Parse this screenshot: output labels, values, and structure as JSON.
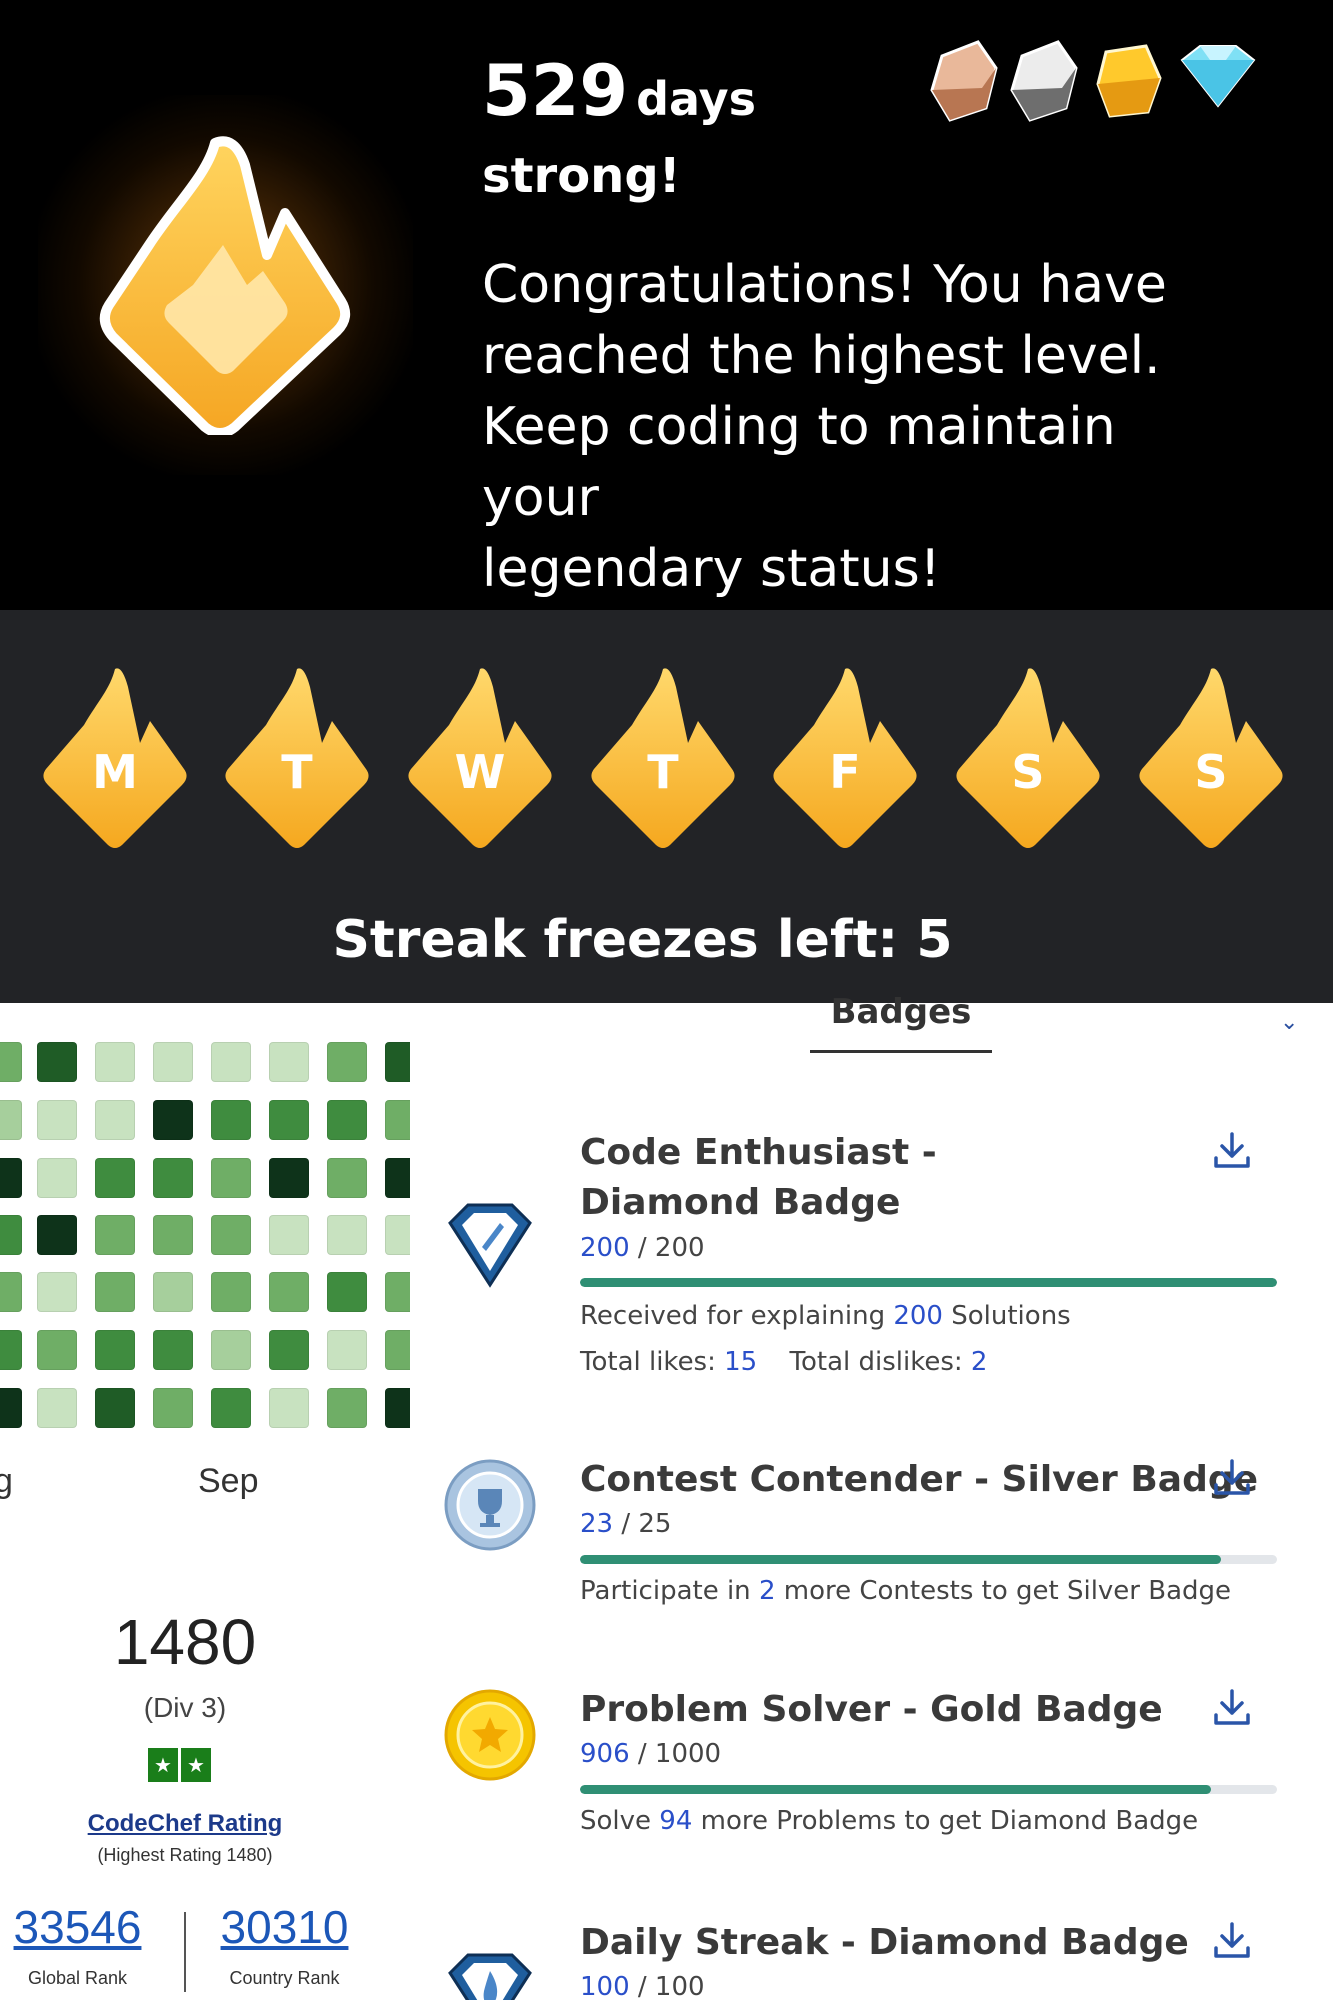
{
  "streak": {
    "days_number": "529",
    "days_unit": "days",
    "line2": "strong!",
    "message": "Congratulations! You have\nreached the highest level.\nKeep coding to maintain your\nlegendary status!",
    "league_icons": [
      "bronze-gem-icon",
      "silver-gem-icon",
      "gold-gem-icon",
      "diamond-gem-icon"
    ],
    "colors": {
      "background": "#000000",
      "flame": "#f7b733",
      "week_bg": "#222326"
    }
  },
  "week": {
    "days": [
      "M",
      "T",
      "W",
      "T",
      "F",
      "S",
      "S"
    ],
    "freezes_text": "Streak freezes left: 5"
  },
  "heatmap": {
    "level_colors": [
      "#c8e2c0",
      "#a6cf9c",
      "#6fae66",
      "#3f8c3f",
      "#1f5c26",
      "#0e331a"
    ],
    "levels": [
      [
        2,
        4,
        0,
        0,
        0,
        0,
        2,
        4
      ],
      [
        1,
        0,
        0,
        5,
        3,
        3,
        3,
        2
      ],
      [
        5,
        0,
        3,
        3,
        2,
        5,
        2,
        5
      ],
      [
        3,
        5,
        2,
        2,
        2,
        0,
        0,
        0
      ],
      [
        2,
        0,
        2,
        1,
        2,
        2,
        3,
        2
      ],
      [
        3,
        2,
        3,
        3,
        1,
        3,
        0,
        2
      ],
      [
        5,
        0,
        4,
        2,
        3,
        0,
        2,
        5
      ]
    ],
    "month_labels": [
      "g",
      "Sep"
    ]
  },
  "rating": {
    "value": "1480",
    "division": "(Div 3)",
    "stars": [
      "★",
      "★"
    ],
    "link_label": "CodeChef Rating",
    "highest": "(Highest Rating 1480)",
    "global_rank": "33546",
    "global_rank_label": "Global Rank",
    "country_rank": "30310",
    "country_rank_label": "Country Rank"
  },
  "badges_section": {
    "tab_label": "Badges",
    "items": [
      {
        "title": "Code Enthusiast - Diamond Badge",
        "icon": "diamond-badge-icon",
        "current": "200",
        "total": "/ 200",
        "progress": 1.0,
        "desc_parts": [
          "Received for explaining ",
          "200",
          " Solutions"
        ],
        "likes_label": "Total likes: ",
        "likes": "15",
        "dislikes_label": "Total dislikes: ",
        "dislikes": "2"
      },
      {
        "title": "Contest Contender - Silver Badge",
        "icon": "silver-trophy-badge-icon",
        "current": "23",
        "total": "/ 25",
        "progress": 0.92,
        "desc_parts": [
          "Participate in ",
          "2",
          " more Contests to get Silver Badge"
        ]
      },
      {
        "title": "Problem Solver - Gold Badge",
        "icon": "gold-badge-icon",
        "current": "906",
        "total": "/ 1000",
        "progress": 0.906,
        "desc_parts": [
          "Solve ",
          "94",
          " more Problems to get Diamond Badge"
        ]
      },
      {
        "title": "Daily Streak - Diamond Badge",
        "icon": "diamond-flame-badge-icon",
        "current": "100",
        "total": "/ 100",
        "progress": 1.0
      }
    ]
  }
}
